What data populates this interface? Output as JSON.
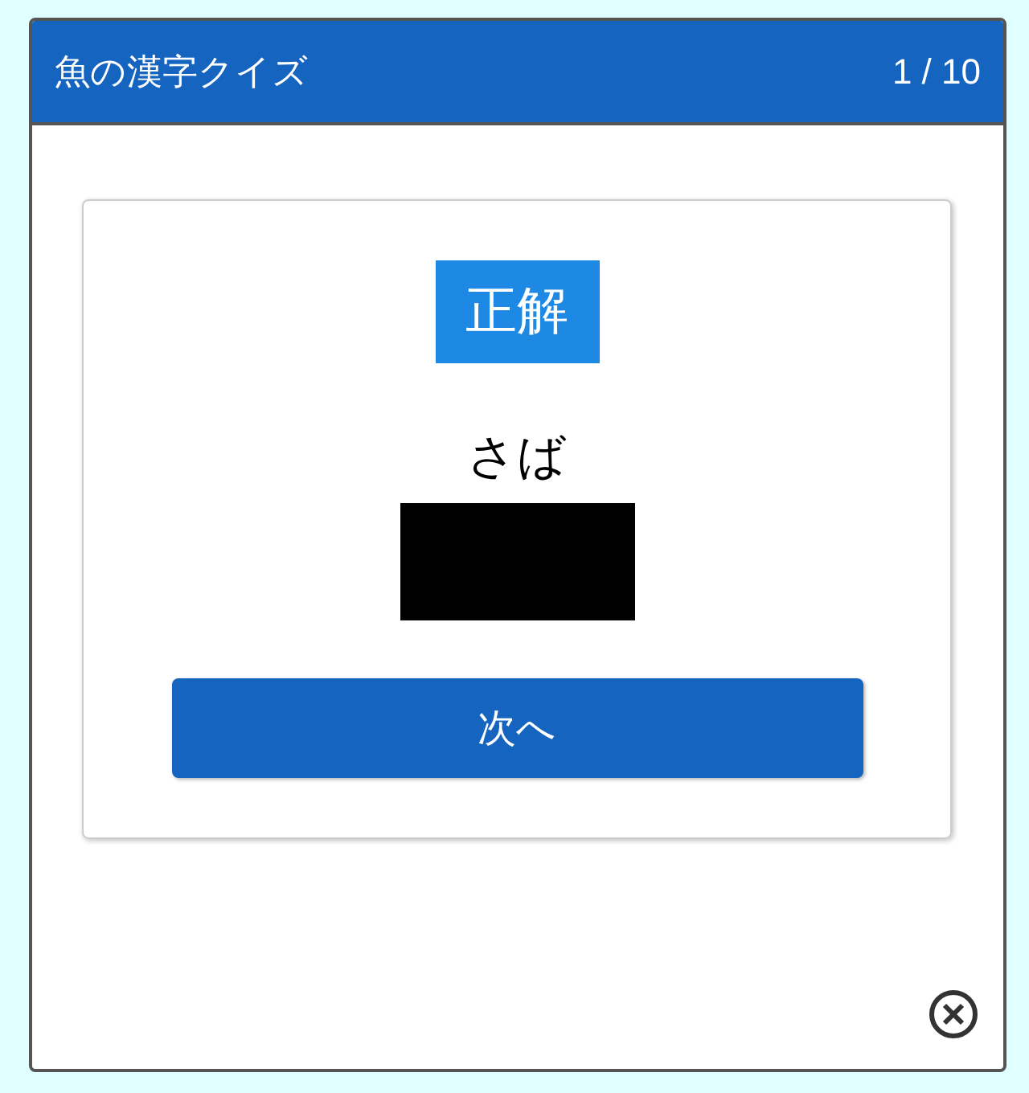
{
  "header": {
    "title": "魚の漢字クイズ",
    "progress": "1 / 10"
  },
  "result": {
    "kind": "correct",
    "label": "正解"
  },
  "reading": "さば",
  "next_button": "次へ"
}
